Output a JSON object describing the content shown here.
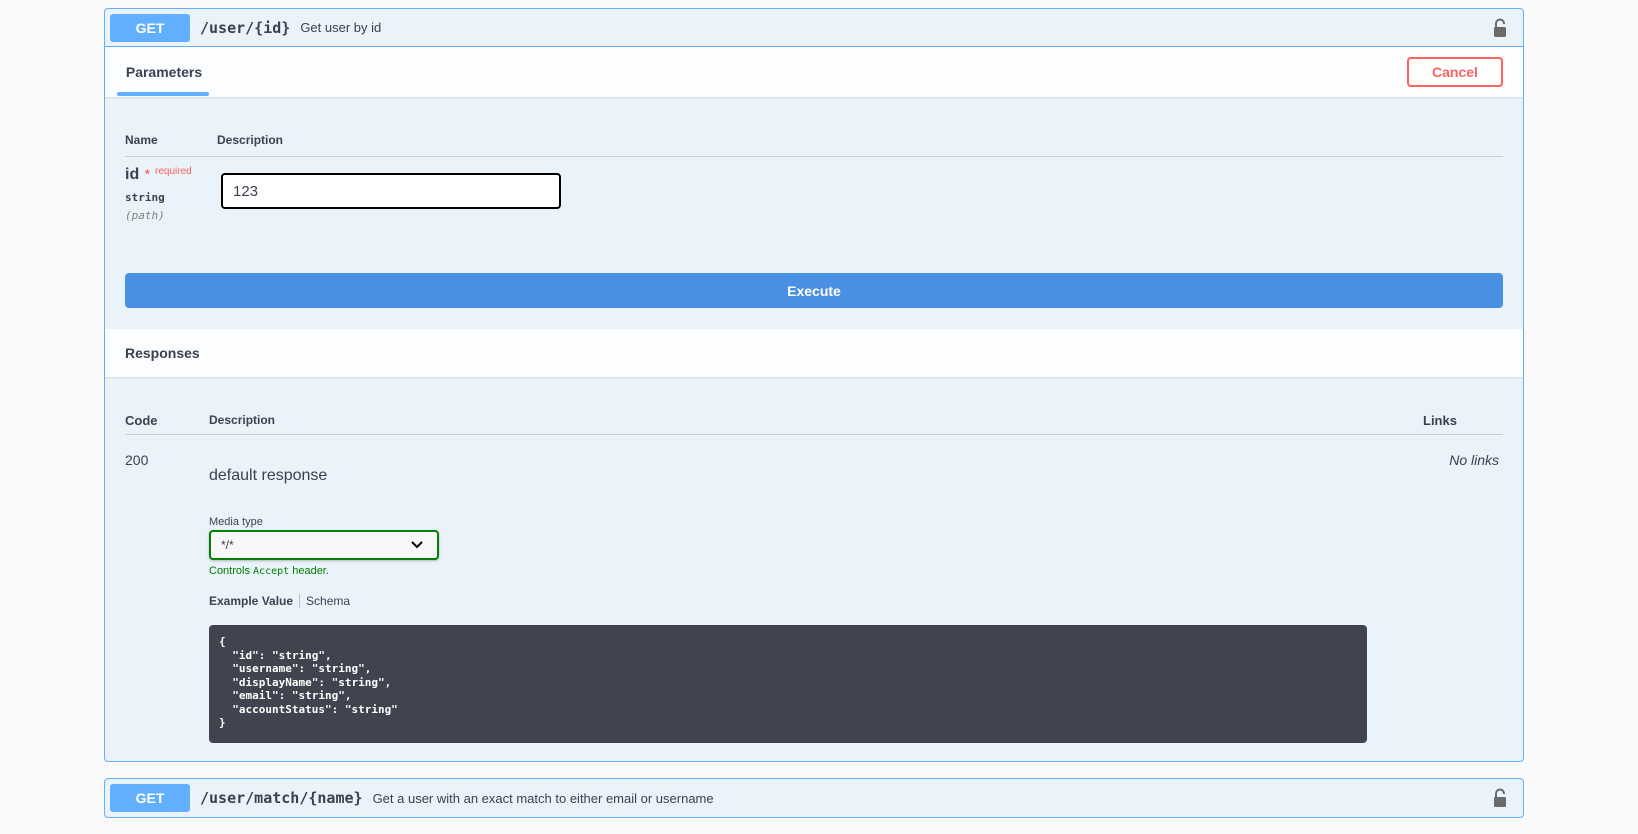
{
  "operation": {
    "method": "GET",
    "path": "/user/{id}",
    "summary": "Get user by id",
    "parameters_tab": "Parameters",
    "cancel_label": "Cancel",
    "param_headers": {
      "name": "Name",
      "description": "Description"
    },
    "param": {
      "name": "id",
      "required_star": "*",
      "required_label": "required",
      "type": "string",
      "in": "(path)",
      "value": "123"
    },
    "execute_label": "Execute",
    "responses_title": "Responses",
    "response_headers": {
      "code": "Code",
      "description": "Description",
      "links": "Links"
    },
    "response": {
      "code": "200",
      "description": "default response",
      "links": "No links",
      "media_type_label": "Media type",
      "media_type_value": "*/*",
      "controls_prefix": "Controls",
      "controls_code": "Accept",
      "controls_suffix": "header.",
      "example_tab": "Example Value",
      "schema_tab": "Schema",
      "example_json": "{\n  \"id\": \"string\",\n  \"username\": \"string\",\n  \"displayName\": \"string\",\n  \"email\": \"string\",\n  \"accountStatus\": \"string\"\n}"
    }
  },
  "operation2": {
    "method": "GET",
    "path": "/user/match/{name}",
    "summary": "Get a user with an exact match to either email or username"
  },
  "colors": {
    "get_method": "#61affe",
    "execute": "#4990e2",
    "cancel": "#ff6060",
    "required": "#ff6060",
    "media_select_border": "#008000"
  },
  "icons": {
    "lock": "lock-icon",
    "chevron": "chevron-down-icon"
  }
}
